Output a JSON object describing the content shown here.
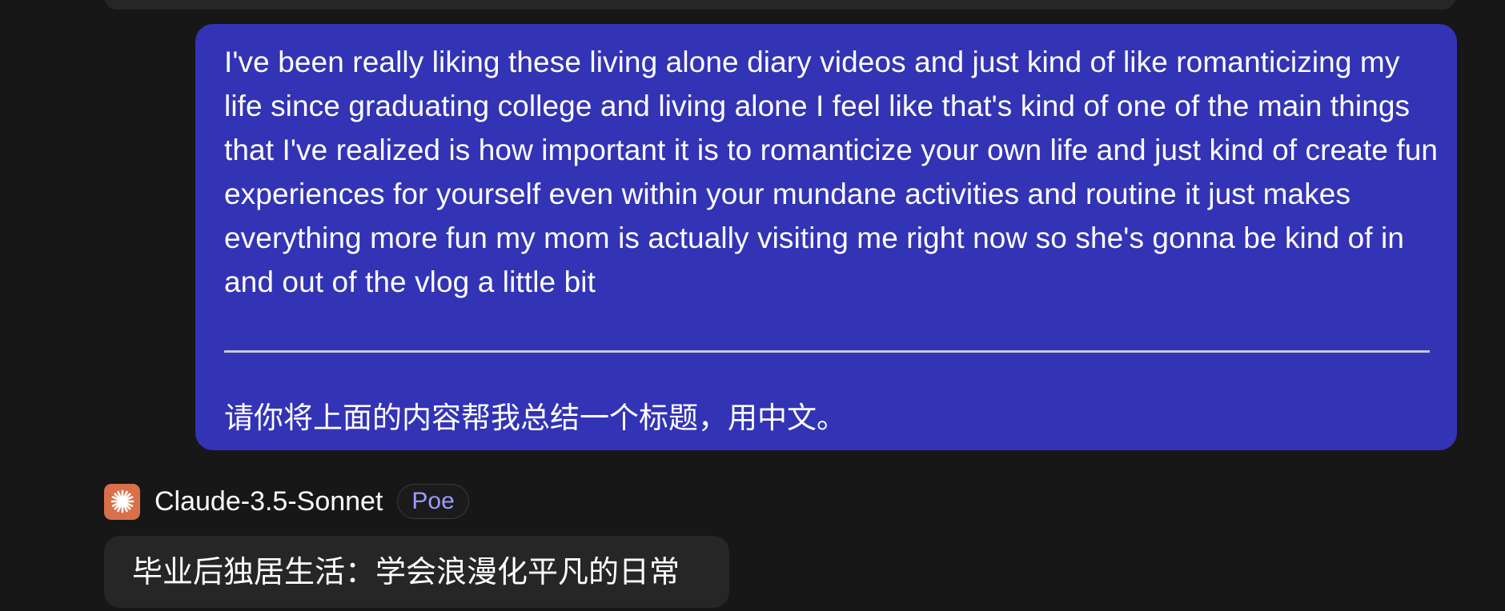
{
  "conversation": {
    "user_message": {
      "text": "I've been really liking these living alone diary videos and just kind of like romanticizing my life since graduating college and living alone I feel like that's kind of one of the main things that I've realized is how important it is to romanticize your own life and just kind of create fun experiences for yourself even within your mundane activities and routine it just makes everything more fun my mom is actually visiting me right now so she's gonna be kind of in and out of the vlog a little bit",
      "followup": "请你将上面的内容帮我总结一个标题，用中文。"
    },
    "bot": {
      "avatar_icon": "claude-sunburst-icon",
      "avatar_color": "#d9704a",
      "name": "Claude-3.5-Sonnet",
      "badge": "Poe",
      "reply": "毕业后独居生活：学会浪漫化平凡的日常"
    }
  },
  "colors": {
    "background": "#171717",
    "user_bubble": "#3333b6",
    "bot_bubble": "#262626",
    "badge_text": "#9b9bff"
  }
}
